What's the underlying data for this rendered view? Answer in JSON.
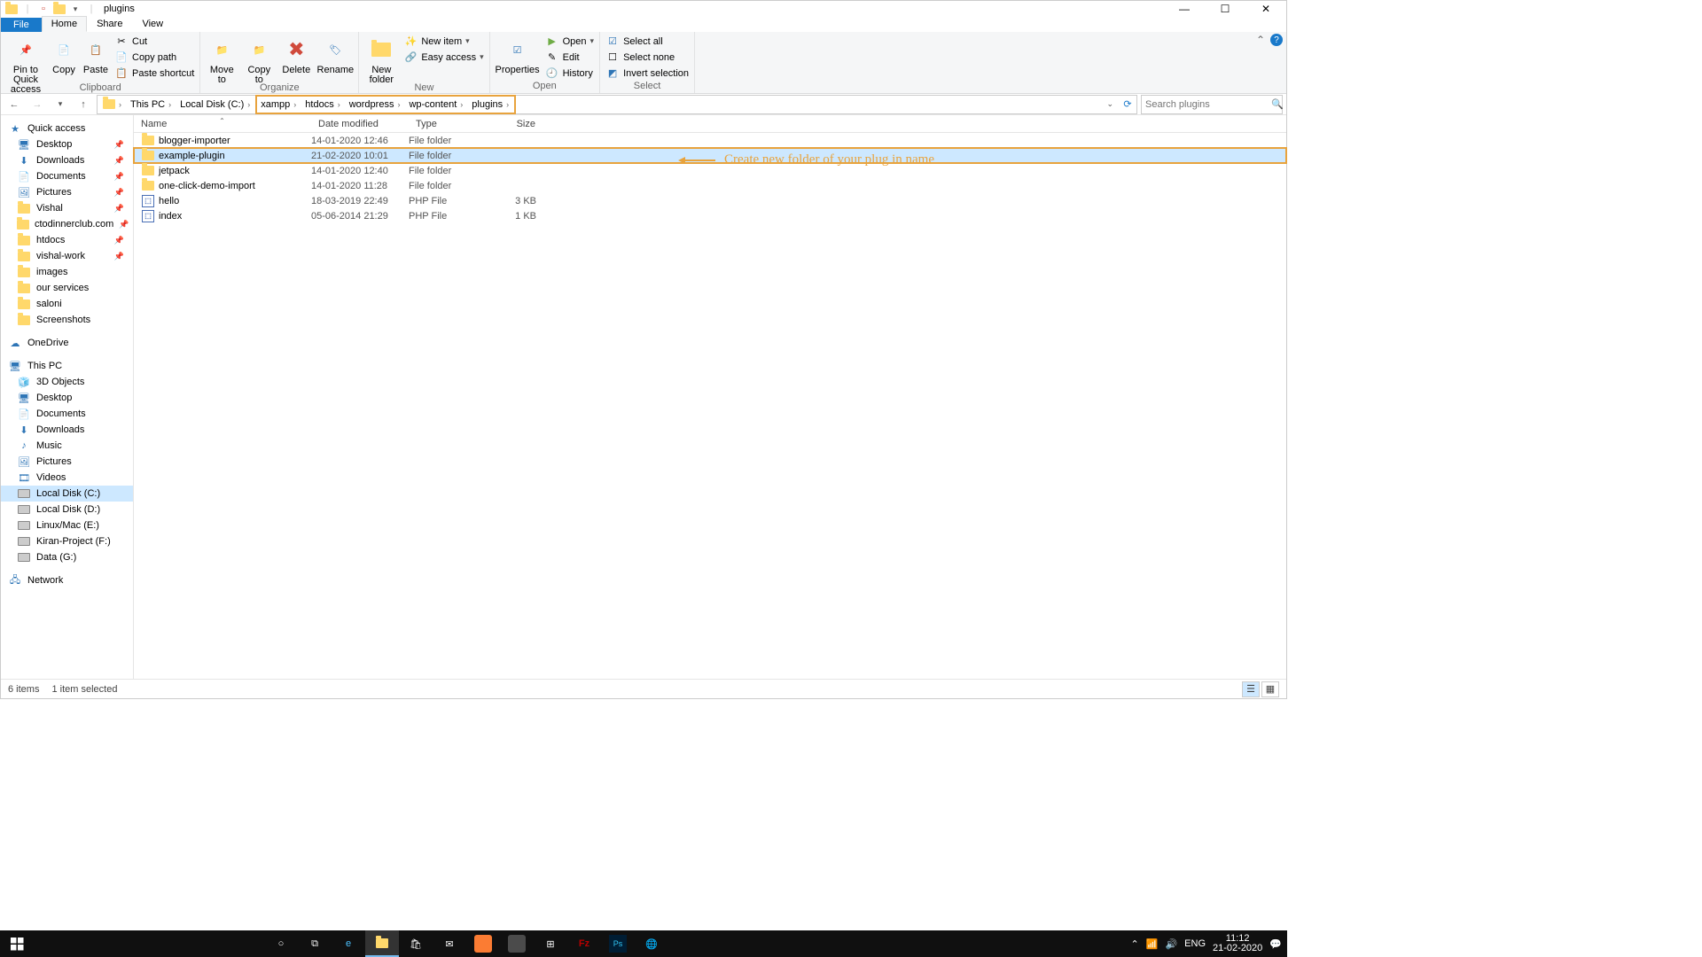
{
  "title": "plugins",
  "tabs": {
    "file": "File",
    "home": "Home",
    "share": "Share",
    "view": "View"
  },
  "ribbon": {
    "clipboard": {
      "label": "Clipboard",
      "pin": "Pin to Quick\naccess",
      "copy": "Copy",
      "paste": "Paste",
      "cut": "Cut",
      "copypath": "Copy path",
      "pastesc": "Paste shortcut"
    },
    "organize": {
      "label": "Organize",
      "move": "Move\nto",
      "copyto": "Copy\nto",
      "delete": "Delete",
      "rename": "Rename"
    },
    "new": {
      "label": "New",
      "newfolder": "New\nfolder",
      "newitem": "New item",
      "easy": "Easy access"
    },
    "open": {
      "label": "Open",
      "properties": "Properties",
      "open": "Open",
      "edit": "Edit",
      "history": "History"
    },
    "select": {
      "label": "Select",
      "all": "Select all",
      "none": "Select none",
      "inv": "Invert selection"
    }
  },
  "breadcrumb": {
    "pc": "This PC",
    "c": "Local Disk (C:)",
    "xampp": "xampp",
    "htdocs": "htdocs",
    "wordpress": "wordpress",
    "wpcontent": "wp-content",
    "plugins": "plugins"
  },
  "search": {
    "placeholder": "Search plugins"
  },
  "columns": {
    "name": "Name",
    "date": "Date modified",
    "type": "Type",
    "size": "Size"
  },
  "rows": [
    {
      "name": "blogger-importer",
      "date": "14-01-2020 12:46",
      "type": "File folder",
      "size": "",
      "icon": "folder"
    },
    {
      "name": "example-plugin",
      "date": "21-02-2020 10:01",
      "type": "File folder",
      "size": "",
      "icon": "folder",
      "selected": true,
      "highlight": true
    },
    {
      "name": "jetpack",
      "date": "14-01-2020 12:40",
      "type": "File folder",
      "size": "",
      "icon": "folder"
    },
    {
      "name": "one-click-demo-import",
      "date": "14-01-2020 11:28",
      "type": "File folder",
      "size": "",
      "icon": "folder"
    },
    {
      "name": "hello",
      "date": "18-03-2019 22:49",
      "type": "PHP File",
      "size": "3 KB",
      "icon": "php"
    },
    {
      "name": "index",
      "date": "05-06-2014 21:29",
      "type": "PHP File",
      "size": "1 KB",
      "icon": "php"
    }
  ],
  "annotation": "Create new folder of your plug in name",
  "nav": {
    "quick": "Quick access",
    "desktop": "Desktop",
    "downloads": "Downloads",
    "documents": "Documents",
    "pictures": "Pictures",
    "vishal": "Vishal",
    "cto": "ctodinnerclub.com",
    "htdocs": "htdocs",
    "vishalwork": "vishal-work",
    "images": "images",
    "ourserv": "our services",
    "saloni": "saloni",
    "screenshots": "Screenshots",
    "onedrive": "OneDrive",
    "thispc": "This PC",
    "obj3d": "3D Objects",
    "desktop2": "Desktop",
    "documents2": "Documents",
    "downloads2": "Downloads",
    "music": "Music",
    "pictures2": "Pictures",
    "videos": "Videos",
    "c": "Local Disk (C:)",
    "d": "Local Disk (D:)",
    "e": "Linux/Mac (E:)",
    "f": "Kiran-Project (F:)",
    "g": "Data (G:)",
    "network": "Network"
  },
  "status": {
    "items": "6 items",
    "sel": "1 item selected"
  },
  "tray": {
    "lang": "ENG",
    "time": "11:12",
    "date": "21-02-2020"
  }
}
